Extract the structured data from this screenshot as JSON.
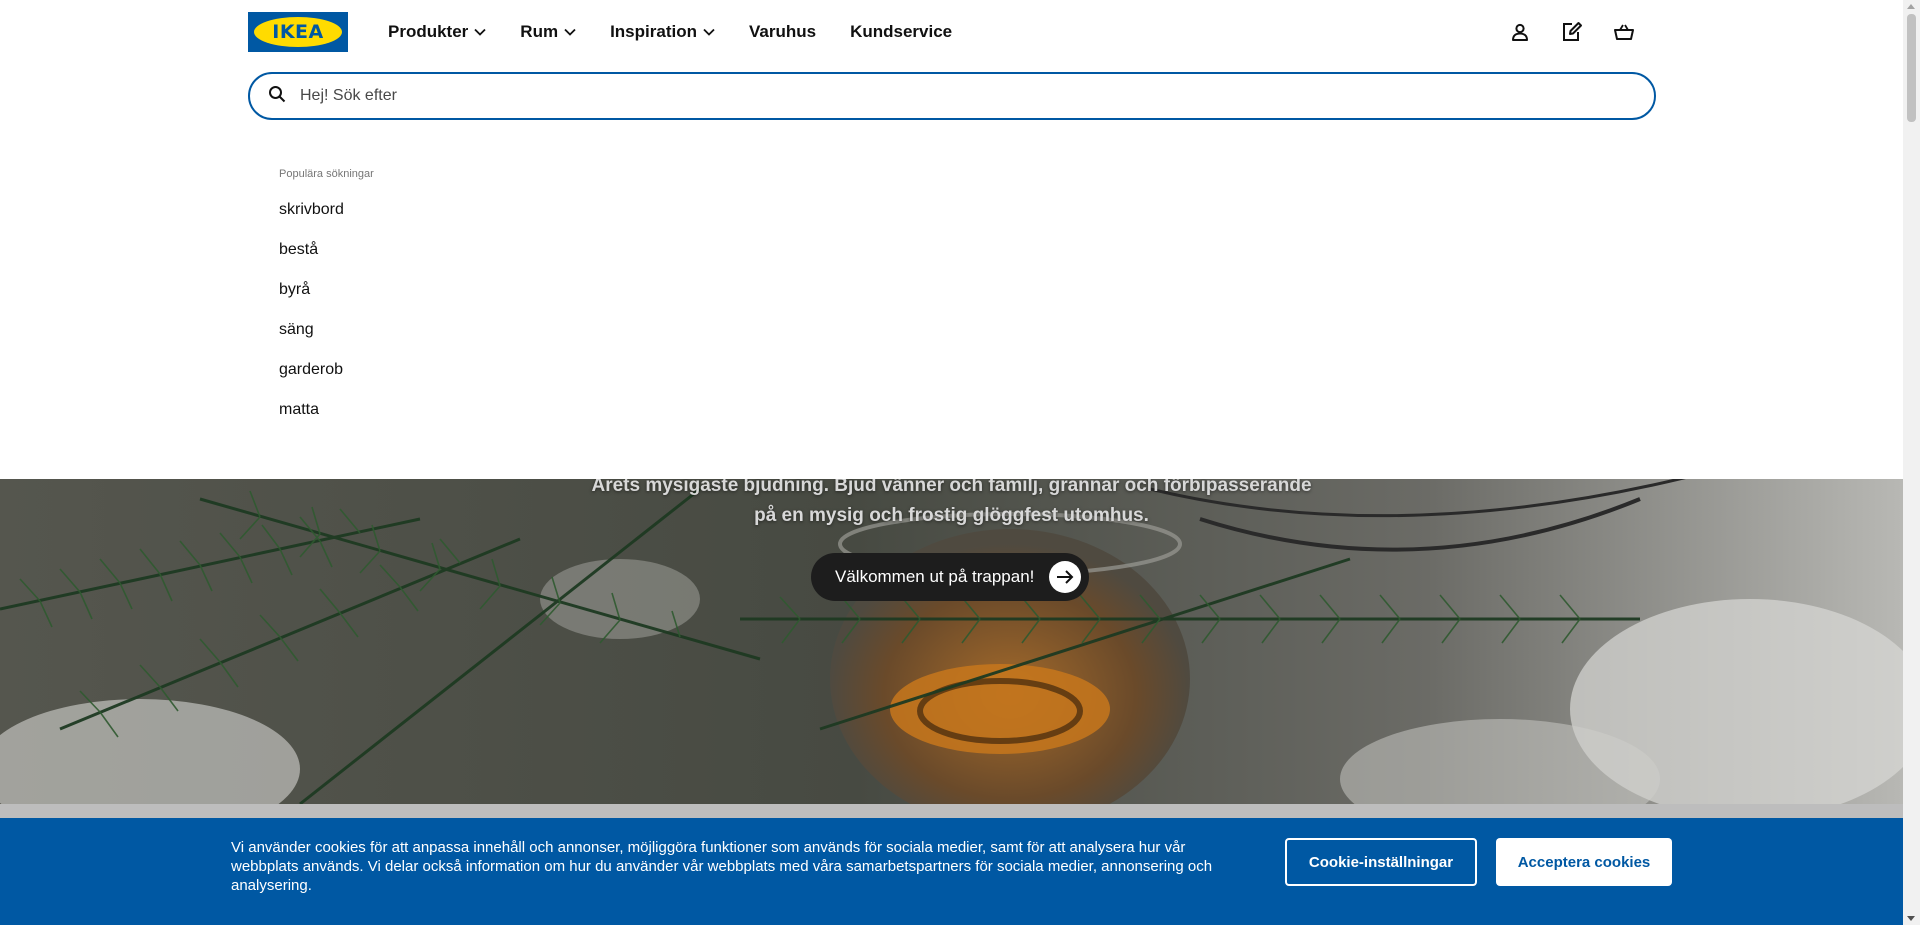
{
  "header": {
    "logo_text": "IKEA",
    "nav": [
      {
        "label": "Produkter",
        "has_dropdown": true
      },
      {
        "label": "Rum",
        "has_dropdown": true
      },
      {
        "label": "Inspiration",
        "has_dropdown": true
      },
      {
        "label": "Varuhus",
        "has_dropdown": false
      },
      {
        "label": "Kundservice",
        "has_dropdown": false
      }
    ],
    "icons": [
      "user-icon",
      "shopping-list-icon",
      "cart-icon"
    ]
  },
  "search": {
    "placeholder": "Hej! Sök efter",
    "value": ""
  },
  "popular": {
    "heading": "Populära sökningar",
    "items": [
      "skrivbord",
      "bestå",
      "byrå",
      "säng",
      "garderob",
      "matta"
    ]
  },
  "hero": {
    "text_line1": "Årets mysigaste bjudning. Bjud vänner och familj, grannar och förbipasserande",
    "text_line2": "på en mysig och frostig glöggfest utomhus.",
    "cta_label": "Välkommen ut på trappan!"
  },
  "cookie": {
    "text": "Vi använder cookies för att anpassa innehåll och annonser, möjliggöra funktioner som används för sociala medier, samt för att analysera hur vår webbplats används. Vi delar också information om hur du använder vår webbplats med våra samarbetspartners för sociala medier, annonsering och analysering.",
    "settings_label": "Cookie-inställningar",
    "accept_label": "Acceptera cookies"
  },
  "colors": {
    "brand_blue": "#0058a3",
    "brand_yellow": "#ffdb00"
  }
}
